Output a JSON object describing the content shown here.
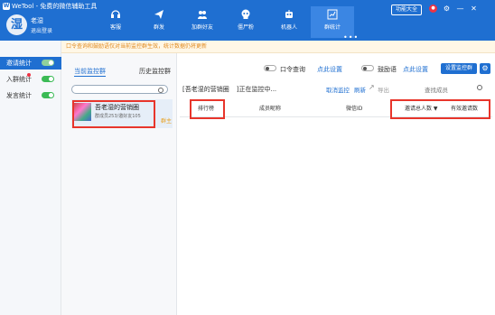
{
  "app": {
    "title": "WeTool - 免费的微信辅助工具",
    "logo_letter": "W"
  },
  "user": {
    "avatar_text": "湿",
    "name": "老湿",
    "logout": "退出登录"
  },
  "nav": [
    {
      "label": "客服",
      "icon": "headset-icon"
    },
    {
      "label": "群发",
      "icon": "send-icon"
    },
    {
      "label": "加群好友",
      "icon": "users-icon"
    },
    {
      "label": "僵尸粉",
      "icon": "skull-icon"
    },
    {
      "label": "机器人",
      "icon": "robot-icon"
    },
    {
      "label": "群统计",
      "icon": "chart-icon",
      "active": true
    }
  ],
  "func_button": "功能大全",
  "sidebar": [
    {
      "label": "邀请统计",
      "active": true
    },
    {
      "label": "入群统计",
      "badge": true
    },
    {
      "label": "发言统计"
    }
  ],
  "notice": "口令查询和鼓励语仅对当前监控群生效，统计数据仍将更新",
  "left": {
    "tab_active": "当前监控群",
    "tab_history": "历史监控群",
    "group": {
      "name": "吾老湿的营销圈",
      "sub": "群成员253/邀好友105",
      "side": "群主"
    }
  },
  "main": {
    "cmd_query": "口令查询",
    "cmd_query_link": "点此设置",
    "encourage": "鼓励语",
    "encourage_link": "点此设置",
    "set_button": "设置监控群",
    "monitor_prefix": "[吾老湿的营销圈",
    "monitor_suffix": "]正在监控中...",
    "cancel_link": "取消监控",
    "refresh_link": "刷新",
    "export": "导出",
    "find_member": "查找成员",
    "columns": [
      "排行榜",
      "成员昵称",
      "微信ID",
      "邀请总人数 ▼",
      "有效邀请数"
    ]
  }
}
